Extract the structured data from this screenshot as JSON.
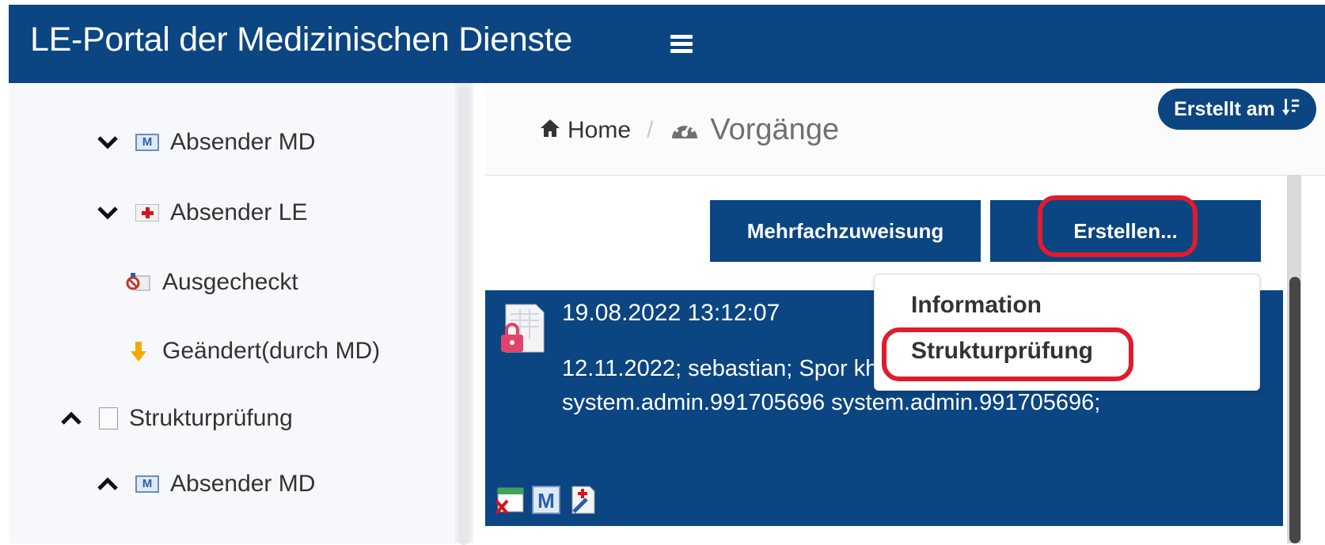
{
  "header": {
    "title": "LE-Portal der Medizinischen Dienste"
  },
  "sidebar": {
    "items": [
      {
        "label": "Absender MD",
        "chevron": "down",
        "icon": "md-icon"
      },
      {
        "label": "Absender LE",
        "chevron": "down",
        "icon": "le-icon"
      },
      {
        "label": "Ausgecheckt",
        "chevron": "",
        "icon": "checked-out-icon"
      },
      {
        "label": "Geändert(durch MD)",
        "chevron": "",
        "icon": "changed-arrow-icon"
      },
      {
        "label": "Strukturprüfung",
        "chevron": "up",
        "icon": "document-icon"
      },
      {
        "label": "Absender MD",
        "chevron": "up",
        "icon": "md-icon"
      }
    ]
  },
  "breadcrumb": {
    "home": "Home",
    "separator": "/",
    "current": "Vorgänge"
  },
  "sort_button": {
    "label": "Erstellt am"
  },
  "toolbar": {
    "multi_assign": "Mehrfachzuweisung",
    "create": "Erstellen..."
  },
  "dropdown": {
    "items": [
      "Information",
      "Strukturprüfung"
    ]
  },
  "card": {
    "date": "19.08.2022 13:12:07",
    "description": "12.11.2022; sebastian; Spor khFallNr123 system.admin.991705696 system.admin.991705696;"
  },
  "colors": {
    "primary": "#0b4582",
    "highlight": "#e01c2b",
    "sidebar_bg": "#f6f8fb"
  }
}
